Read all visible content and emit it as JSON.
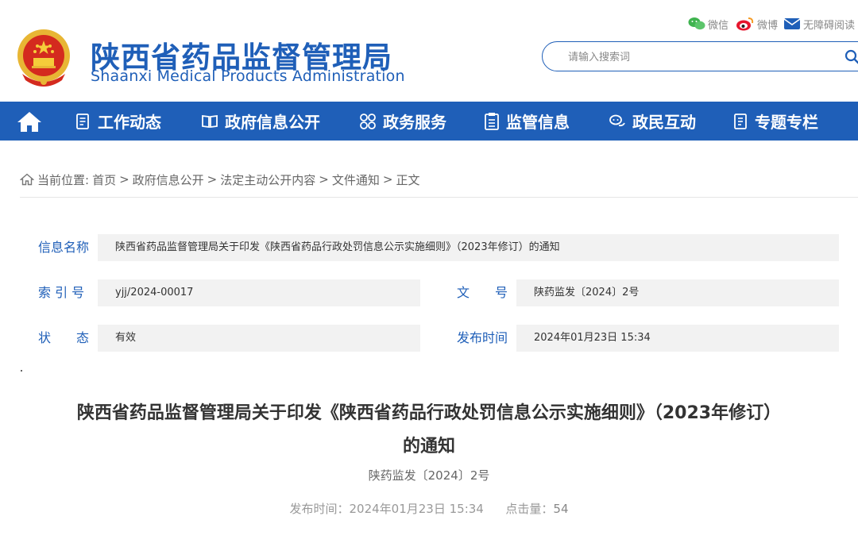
{
  "header": {
    "title_cn": "陕西省药品监督管理局",
    "title_en": "Shaanxi Medical Products Administration",
    "social": {
      "wechat": "微信",
      "weibo": "微博",
      "accessibility": "无障碍阅读"
    },
    "search_placeholder": "请输入搜索词"
  },
  "nav": {
    "items": [
      "工作动态",
      "政府信息公开",
      "政务服务",
      "监管信息",
      "政民互动",
      "专题专栏"
    ]
  },
  "breadcrumb": {
    "prefix": "当前位置:",
    "items": [
      "首页",
      "政府信息公开",
      "法定主动公开内容",
      "文件通知",
      "正文"
    ],
    "separator": ">"
  },
  "info": {
    "name_label": "信息名称",
    "name_value": "陕西省药品监督管理局关于印发《陕西省药品行政处罚信息公示实施细则》（2023年修订）的通知",
    "index_label": "索 引 号",
    "index_value": "yjj/2024-00017",
    "docno_label": "文　　号",
    "docno_value": "陕药监发〔2024〕2号",
    "status_label": "状　　态",
    "status_value": "有效",
    "date_label": "发布时间",
    "date_value": "2024年01月23日 15:34"
  },
  "article": {
    "title_line1": "陕西省药品监督管理局关于印发《陕西省药品行政处罚信息公示实施细则》（2023年修订）",
    "title_line2": "的通知",
    "doc_no": "陕药监发〔2024〕2号",
    "publish_label": "发布时间：",
    "publish_time": "2024年01月23日 15:34",
    "clicks_label": "点击量：",
    "clicks": "54"
  },
  "colors": {
    "brand": "#1f5fb8",
    "field_bg": "#f2f2f2"
  }
}
